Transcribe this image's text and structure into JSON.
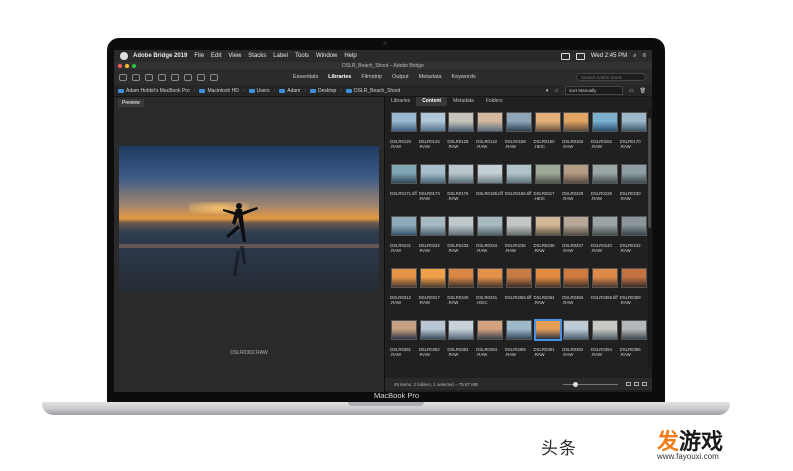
{
  "menubar": {
    "app_name": "Adobe Bridge 2019",
    "items": [
      "File",
      "Edit",
      "View",
      "Stacks",
      "Label",
      "Tools",
      "Window",
      "Help"
    ],
    "clock": "Wed 2:45 PM"
  },
  "window": {
    "title": "DSLR_Beach_Shoot – Adobe Bridge"
  },
  "toolbar": {
    "workspaces": [
      "Essentials",
      "Libraries",
      "Filmstrip",
      "Output",
      "Metadata",
      "Keywords"
    ],
    "active_workspace": "Libraries",
    "search_placeholder": "Search Adobe Stock"
  },
  "path": {
    "crumbs": [
      "Adam Hobbit's MacBook Pro",
      "Macintosh HD",
      "Users",
      "Adam",
      "Desktop",
      "DSLR_Beach_Shoot"
    ],
    "sort_label": "Sort Manually"
  },
  "preview": {
    "tab_label": "Preview",
    "caption": "DSLR0302.RAW"
  },
  "content": {
    "tabs": [
      "Libraries",
      "Content",
      "Metadata",
      "Folders"
    ],
    "active_tab": "Content",
    "thumbs": [
      {
        "label": "DSLR0120\n.RAW",
        "colors": [
          "#9ab9d1",
          "#3d5f80"
        ]
      },
      {
        "label": "DSLR0126\n.RAW",
        "colors": [
          "#b0c7d8",
          "#55748f"
        ]
      },
      {
        "label": "DSLR0129\n.RAW",
        "colors": [
          "#c9c4bb",
          "#4c6077"
        ]
      },
      {
        "label": "DSLR0142\n.RAW",
        "colors": [
          "#d4b99e",
          "#5c6e83"
        ]
      },
      {
        "label": "DSLR0158\n.RAW",
        "colors": [
          "#8fa6b9",
          "#2d4055"
        ]
      },
      {
        "label": "DSLR0160\n.HEIC",
        "colors": [
          "#e6b07a",
          "#6a5445"
        ]
      },
      {
        "label": "DSLR0165\n.RAW",
        "colors": [
          "#e1a463",
          "#5d4a3c"
        ]
      },
      {
        "label": "DSLR0162\n.RAW",
        "colors": [
          "#7bb0cf",
          "#27506e"
        ]
      },
      {
        "label": "DSLR0170\n.RAW",
        "colors": [
          "#9cb7c9",
          "#3b5568"
        ]
      },
      {
        "label": "DSLR0171.tiff",
        "colors": [
          "#80a5b5",
          "#2e4a57"
        ]
      },
      {
        "label": "DSLR0173\n.RAW",
        "colors": [
          "#a5bfcb",
          "#486674"
        ]
      },
      {
        "label": "DSLR0176\n.RAW",
        "colors": [
          "#b9c7cd",
          "#5a6e78"
        ]
      },
      {
        "label": "DSLR0185.tiff",
        "colors": [
          "#c4d0d4",
          "#6c7f87"
        ]
      },
      {
        "label": "DSLR0186.tiff",
        "colors": [
          "#b2c3c9",
          "#5e737c"
        ]
      },
      {
        "label": "DSLR0217\n.HEIC",
        "colors": [
          "#a0aa9a",
          "#4c5548"
        ]
      },
      {
        "label": "DSLR0228\n.RAW",
        "colors": [
          "#b49c86",
          "#584a3e"
        ]
      },
      {
        "label": "DSLR0229\n.RAW",
        "colors": [
          "#9aa7a6",
          "#434e4e"
        ]
      },
      {
        "label": "DSLR0230\n.RAW",
        "colors": [
          "#8e9ea3",
          "#3d4a4f"
        ]
      },
      {
        "label": "DSLR0231\n.RAW",
        "colors": [
          "#8ea9b9",
          "#39556a"
        ]
      },
      {
        "label": "DSLR0232\n.RAW",
        "colors": [
          "#a7bac4",
          "#4d6270"
        ]
      },
      {
        "label": "DSLR0233\n.RAW",
        "colors": [
          "#bfc9cc",
          "#637177"
        ]
      },
      {
        "label": "DSLR0234\n.RAW",
        "colors": [
          "#a9b9c0",
          "#52626a"
        ]
      },
      {
        "label": "DSLR0235\n.RAW",
        "colors": [
          "#c2c7c4",
          "#6a706e"
        ]
      },
      {
        "label": "DSLR0236\n.RAW",
        "colors": [
          "#d1b896",
          "#5e5344"
        ]
      },
      {
        "label": "DSLR0237\n.RAW",
        "colors": [
          "#b6a797",
          "#554d45"
        ]
      },
      {
        "label": "DSLR0240\n.RAW",
        "colors": [
          "#9ba4a5",
          "#454c4e"
        ]
      },
      {
        "label": "DSLR0242\n.RAW",
        "colors": [
          "#8a969b",
          "#3a4347"
        ]
      },
      {
        "label": "DSLR0312\n.RAW",
        "colors": [
          "#e59447",
          "#4a3a31"
        ]
      },
      {
        "label": "DSLR0317\n.RAW",
        "colors": [
          "#f0a24b",
          "#503b2c"
        ]
      },
      {
        "label": "DSLR0340\n.RAW",
        "colors": [
          "#d98743",
          "#3f3029"
        ]
      },
      {
        "label": "DSLR0341\n.HEIC",
        "colors": [
          "#e4924a",
          "#45352b"
        ]
      },
      {
        "label": "DSLR0356.tiff",
        "colors": [
          "#c77c46",
          "#3b2d27"
        ]
      },
      {
        "label": "DSLR0364\n.RAW",
        "colors": [
          "#e38b41",
          "#4a362a"
        ]
      },
      {
        "label": "DSLR0366\n.RAW",
        "colors": [
          "#d07a3f",
          "#3f2f27"
        ]
      },
      {
        "label": "DSLR0368.tiff",
        "colors": [
          "#dd8a48",
          "#47362c"
        ]
      },
      {
        "label": "DSLR0369\n.RAW",
        "colors": [
          "#c47244",
          "#3a2b26"
        ]
      },
      {
        "label": "DSLR0381\n.RAW",
        "colors": [
          "#c6a082",
          "#2f3644"
        ]
      },
      {
        "label": "DSLR0382\n.RAW",
        "colors": [
          "#b8c7d3",
          "#3b4c5e"
        ]
      },
      {
        "label": "DSLR0383\n.RAW",
        "colors": [
          "#c7d2d8",
          "#56687a"
        ]
      },
      {
        "label": "DSLR0384\n.RAW",
        "colors": [
          "#d4a17f",
          "#3c3f4c"
        ]
      },
      {
        "label": "DSLR0389\n.RAW",
        "colors": [
          "#9fb9cc",
          "#2f4559"
        ]
      },
      {
        "label": "DSLR0391\n.RAW",
        "colors": [
          "#e39d55",
          "#2a3447"
        ]
      },
      {
        "label": "DSLR0392\n.RAW",
        "colors": [
          "#bdcad4",
          "#4d5d6d"
        ]
      },
      {
        "label": "DSLR0394\n.RAW",
        "colors": [
          "#c9c7c4",
          "#535f6b"
        ]
      },
      {
        "label": "DSLR0396\n.RAW",
        "colors": [
          "#b5b8ba",
          "#414a54"
        ]
      }
    ],
    "selected_label": "DSLR0391\n.RAW",
    "status": "45 items, 2 folders, 1 selected – 75.87 MB"
  },
  "device": {
    "label": "MacBook Pro"
  },
  "watermark": {
    "left_text": "头条",
    "logo_lead": "发",
    "logo_rest": "游戏",
    "url": "www.fayouxi.com"
  }
}
